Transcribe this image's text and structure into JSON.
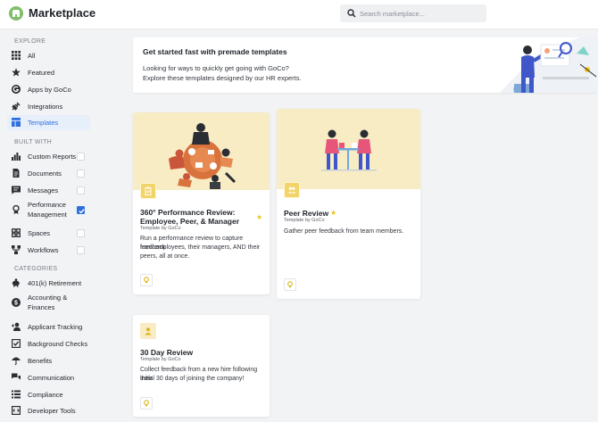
{
  "header": {
    "title": "Marketplace",
    "logo_icon": "store-icon",
    "search": {
      "placeholder": "Search marketplace...",
      "value": ""
    }
  },
  "sidebar": {
    "explore_title": "EXPLORE",
    "explore": [
      {
        "label": "All",
        "icon": "grid-icon"
      },
      {
        "label": "Featured",
        "icon": "star-icon"
      },
      {
        "label": "Apps by GoCo",
        "icon": "goco-icon"
      },
      {
        "label": "Integrations",
        "icon": "plug-icon"
      },
      {
        "label": "Templates",
        "icon": "template-icon",
        "active": true
      }
    ],
    "built_with_title": "BUILT WITH",
    "built_with": [
      {
        "label": "Custom Reports",
        "icon": "bar-chart-icon",
        "checked": false
      },
      {
        "label": "Documents",
        "icon": "document-icon",
        "checked": false
      },
      {
        "label": "Messages",
        "icon": "message-icon",
        "checked": false
      },
      {
        "label": "Performance Management",
        "icon": "ribbon-icon",
        "checked": true
      },
      {
        "label": "Spaces",
        "icon": "spaces-icon",
        "checked": false
      },
      {
        "label": "Workflows",
        "icon": "workflow-icon",
        "checked": false
      }
    ],
    "categories_title": "CATEGORIES",
    "categories": [
      {
        "label": "401(k) Retirement",
        "icon": "piggy-bank-icon"
      },
      {
        "label": "Accounting & Finances",
        "icon": "dollar-icon"
      },
      {
        "label": "Applicant Tracking",
        "icon": "add-user-icon"
      },
      {
        "label": "Background Checks",
        "icon": "check-square-icon"
      },
      {
        "label": "Benefits",
        "icon": "umbrella-icon"
      },
      {
        "label": "Communication",
        "icon": "chat-icon"
      },
      {
        "label": "Compliance",
        "icon": "list-icon"
      },
      {
        "label": "Developer Tools",
        "icon": "developer-icon"
      }
    ]
  },
  "banner": {
    "title": "Get started fast with premade templates",
    "line1": "Looking for ways to quickly get going with GoCo?",
    "line2": "Explore these templates designed by our HR experts."
  },
  "cards": [
    {
      "title_line1": "360° Performance Review:",
      "title_line2": "Employee, Peer, & Manager",
      "subtitle": "Template by GoCo",
      "desc": [
        "Run a performance review to capture feedback",
        "from employees, their managers, AND their",
        "peers, all at once."
      ],
      "featured": true
    },
    {
      "title_line1": "Peer Review",
      "subtitle": "Template by GoCo",
      "desc": [
        "Gather peer feedback from team members."
      ],
      "featured": true
    },
    {
      "title_line1": "30 Day Review",
      "subtitle": "Template by GoCo",
      "desc": [
        "Collect feedback from a new hire following their",
        "initial 30 days of joining the company!"
      ],
      "featured": false
    }
  ],
  "colors": {
    "accent": "#2f6fde",
    "card_hero": "#f8ecc5",
    "badge": "#f2d46a",
    "star": "#f0c419"
  }
}
